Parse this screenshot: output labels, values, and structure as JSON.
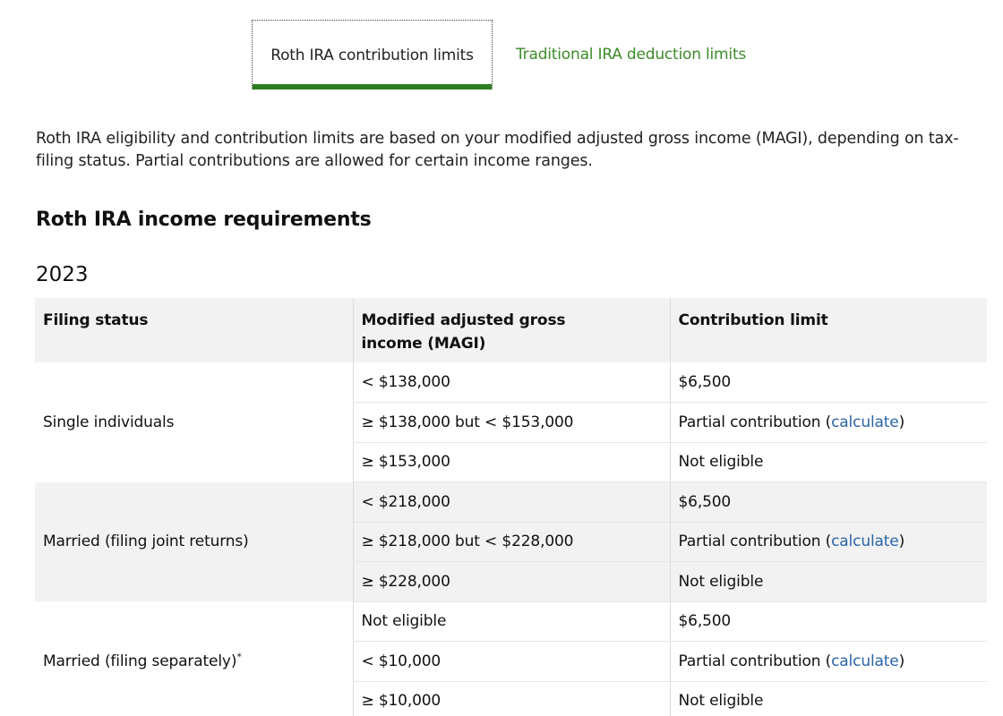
{
  "tabs": [
    {
      "label": "Roth IRA contribution limits",
      "active": true
    },
    {
      "label": "Traditional IRA deduction limits",
      "active": false
    }
  ],
  "intro_text": "Roth IRA eligibility and contribution limits are based on your modified adjusted gross income (MAGI), depending on tax-filing status. Partial contributions are allowed for certain income ranges.",
  "section_title": "Roth IRA income requirements",
  "year": "2023",
  "table": {
    "headers": {
      "status": "Filing status",
      "magi": "Modified adjusted gross income (MAGI)",
      "limit": "Contribution limit"
    },
    "groups": [
      {
        "status": "Single individuals",
        "footnote": "",
        "rows": [
          {
            "magi": "< $138,000",
            "limit": "$6,500"
          },
          {
            "magi": "≥ $138,000 but < $153,000",
            "limit_prefix": "Partial contribution (",
            "limit_link": "calculate",
            "limit_suffix": ")"
          },
          {
            "magi": "≥ $153,000",
            "limit": "Not eligible"
          }
        ]
      },
      {
        "status": "Married (filing joint returns)",
        "footnote": "",
        "rows": [
          {
            "magi": "< $218,000",
            "limit": "$6,500"
          },
          {
            "magi": "≥ $218,000 but < $228,000",
            "limit_prefix": "Partial contribution (",
            "limit_link": "calculate",
            "limit_suffix": ")"
          },
          {
            "magi": "≥ $228,000",
            "limit": "Not eligible"
          }
        ]
      },
      {
        "status": "Married (filing separately)",
        "footnote": "*",
        "rows": [
          {
            "magi": "Not eligible",
            "limit": "$6,500"
          },
          {
            "magi": "< $10,000",
            "limit_prefix": "Partial contribution (",
            "limit_link": "calculate",
            "limit_suffix": ")"
          },
          {
            "magi": "≥ $10,000",
            "limit": "Not eligible"
          }
        ]
      }
    ]
  },
  "colors": {
    "accent_green": "#2e7d1f",
    "tab_link_green": "#3d8b2a",
    "link_blue": "#2a64a8",
    "shade_gray": "#f2f2f2"
  }
}
